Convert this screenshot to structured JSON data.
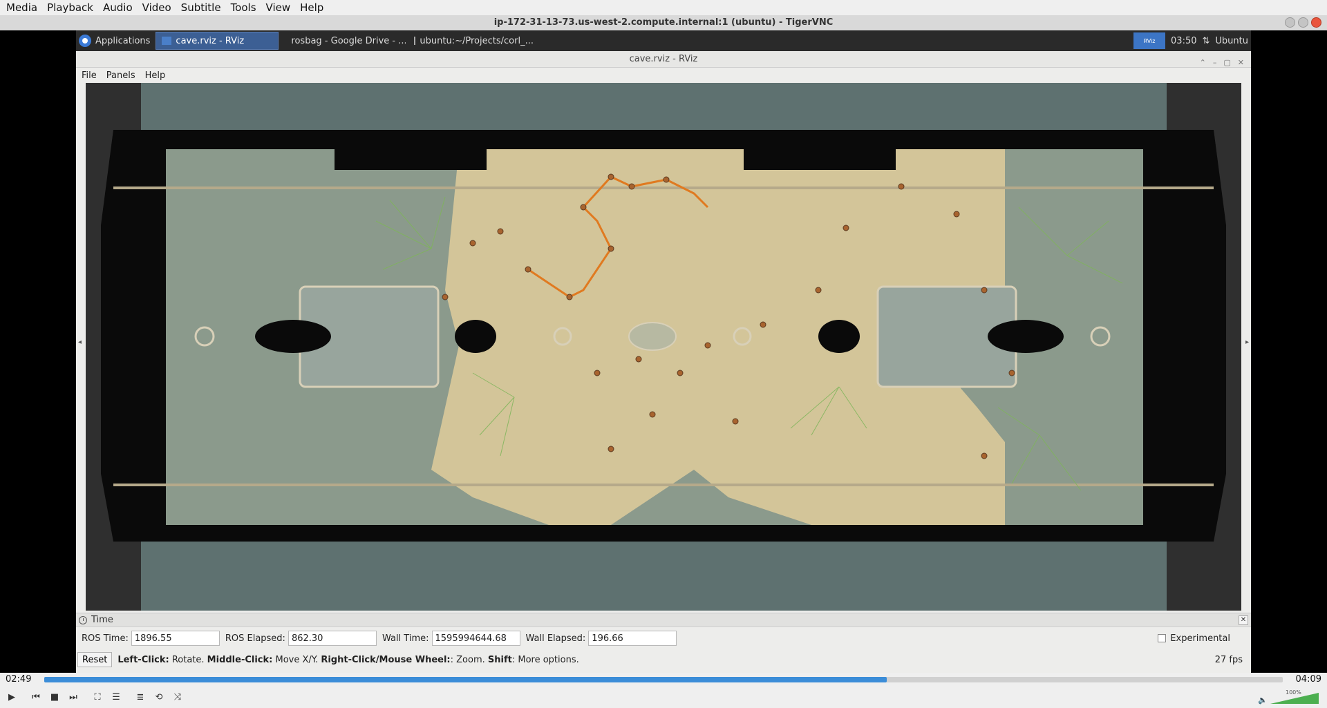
{
  "vlc": {
    "menu": [
      "Media",
      "Playback",
      "Audio",
      "Video",
      "Subtitle",
      "Tools",
      "View",
      "Help"
    ],
    "elapsed": "02:49",
    "total": "04:09",
    "progress": 0.68,
    "volume_label": "100%",
    "volume": 1.0
  },
  "vnc": {
    "title": "ip-172-31-13-73.us-west-2.compute.internal:1 (ubuntu) - TigerVNC"
  },
  "panel": {
    "applications": "Applications",
    "tasks": [
      "cave.rviz - RViz",
      "rosbag - Google Drive - ...",
      "ubuntu:~/Projects/corl_..."
    ],
    "clock": "03:50",
    "user": "Ubuntu",
    "tray_label": "RViz"
  },
  "rviz": {
    "title": "cave.rviz - RViz",
    "menu": [
      "File",
      "Panels",
      "Help"
    ],
    "time_panel": {
      "title": "Time",
      "ros_time_label": "ROS Time:",
      "ros_time": "1896.55",
      "ros_elapsed_label": "ROS Elapsed:",
      "ros_elapsed": "862.30",
      "wall_time_label": "Wall Time:",
      "wall_time": "1595994644.68",
      "wall_elapsed_label": "Wall Elapsed:",
      "wall_elapsed": "196.66",
      "experimental_label": "Experimental"
    },
    "reset_label": "Reset",
    "help": {
      "left_b": "Left-Click:",
      "left_t": " Rotate. ",
      "mid_b": "Middle-Click:",
      "mid_t": " Move X/Y. ",
      "right_b": "Right-Click/Mouse Wheel:",
      "right_t": ": Zoom. ",
      "shift_b": "Shift",
      "shift_t": ": More options."
    },
    "fps": "27 fps"
  },
  "colors": {
    "accent": "#3b8dd8",
    "sand": "#d3c599",
    "floor": "#8b9a8c",
    "edge": "#e07a20"
  }
}
